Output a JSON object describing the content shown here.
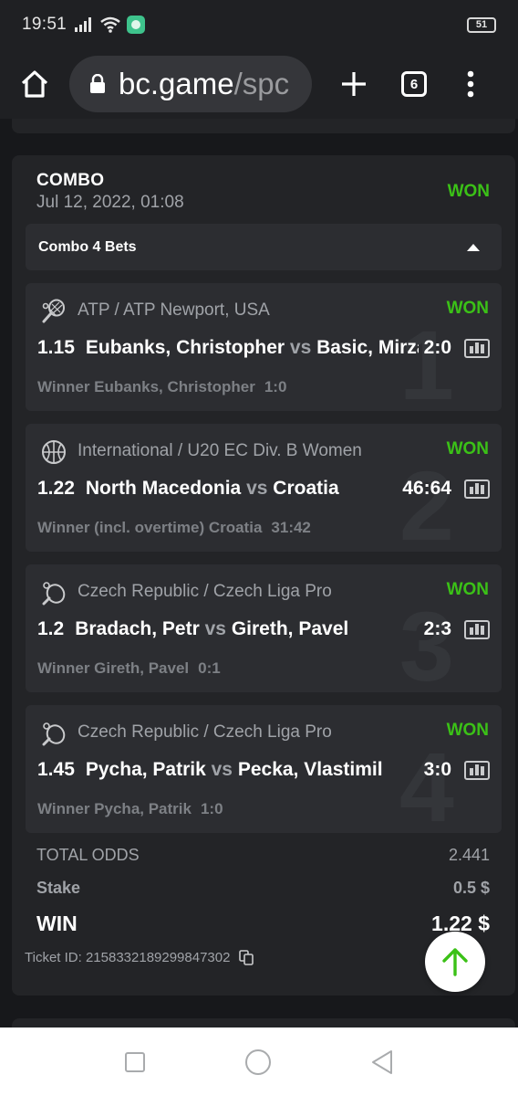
{
  "status_bar": {
    "time": "19:51",
    "battery": "51",
    "icons": [
      "signal-icon",
      "wifi-icon",
      "app-notification-icon",
      "battery-icon"
    ]
  },
  "browser": {
    "url_host": "bc.game",
    "url_path": "/spc",
    "tab_count": "6",
    "icons": [
      "home-icon",
      "lock-icon",
      "plus-icon",
      "tabs-icon",
      "more-vert-icon"
    ]
  },
  "bet_card": {
    "type": "COMBO",
    "date": "Jul 12, 2022, 01:08",
    "status": "WON",
    "combo_label": "Combo 4 Bets",
    "bets": [
      {
        "index": "1",
        "sport_icon": "tennis-icon",
        "league": "ATP / ATP Newport, USA",
        "status": "WON",
        "odds": "1.15",
        "home": "Eubanks, Christopher",
        "vs": "vs",
        "away": "Basic, Mirza",
        "score": "2:0",
        "pick": "Winner Eubanks, Christopher",
        "pick_score": "1:0"
      },
      {
        "index": "2",
        "sport_icon": "basketball-icon",
        "league": "International / U20 EC Div. B Women",
        "status": "WON",
        "odds": "1.22",
        "home": "North Macedonia",
        "vs": "vs",
        "away": "Croatia",
        "score": "46:64",
        "pick": "Winner (incl. overtime) Croatia",
        "pick_score": "31:42"
      },
      {
        "index": "3",
        "sport_icon": "table-tennis-icon",
        "league": "Czech Republic / Czech Liga Pro",
        "status": "WON",
        "odds": "1.2",
        "home": "Bradach, Petr",
        "vs": "vs",
        "away": "Gireth, Pavel",
        "score": "2:3",
        "pick": "Winner Gireth, Pavel",
        "pick_score": "0:1"
      },
      {
        "index": "4",
        "sport_icon": "table-tennis-icon",
        "league": "Czech Republic / Czech Liga Pro",
        "status": "WON",
        "odds": "1.45",
        "home": "Pycha, Patrik",
        "vs": "vs",
        "away": "Pecka, Vlastimil",
        "score": "3:0",
        "pick": "Winner Pycha, Patrik",
        "pick_score": "1:0"
      }
    ],
    "total_odds_label": "TOTAL ODDS",
    "total_odds": "2.441",
    "stake_label": "Stake",
    "stake": "0.5 $",
    "win_label": "WIN",
    "win": "1.22 $",
    "ticket_label": "Ticket ID: 2158332189299847302"
  },
  "colors": {
    "accent_won": "#3bc117",
    "scroll_top_arrow": "#3bc117",
    "background": "#17181b",
    "card": "#232427",
    "bet_item": "#2c2d31"
  },
  "nav_bar": {
    "icons": [
      "recents-square-icon",
      "home-circle-icon",
      "back-triangle-icon"
    ]
  }
}
